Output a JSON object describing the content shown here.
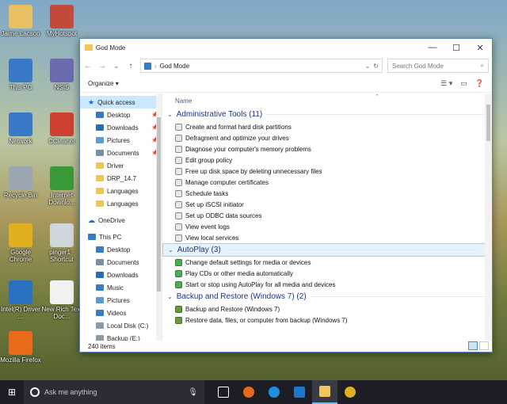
{
  "desktop": {
    "icons": [
      {
        "label": "Jaime Lacson",
        "icon": "user-folder-icon",
        "color": "#e8c064"
      },
      {
        "label": "MyHotspot",
        "icon": "hotspot-icon",
        "color": "#c44a3c"
      },
      {
        "label": "This PC",
        "icon": "computer-icon",
        "color": "#3a78c8"
      },
      {
        "label": "NSIS",
        "icon": "installer-icon",
        "color": "#6b6bb0"
      },
      {
        "label": "Network",
        "icon": "network-icon",
        "color": "#3a78c8"
      },
      {
        "label": "CCleaner",
        "icon": "ccleaner-icon",
        "color": "#d04030"
      },
      {
        "label": "Recycle Bin",
        "icon": "recycle-bin-icon",
        "color": "#9aa6b0"
      },
      {
        "label": "Internet Downlo...",
        "icon": "download-manager-icon",
        "color": "#3a9a3a"
      },
      {
        "label": "Google Chrome",
        "icon": "chrome-icon",
        "color": "#e0b020"
      },
      {
        "label": "pinger1 - Shortcut",
        "icon": "shortcut-icon",
        "color": "#cfd6dc"
      },
      {
        "label": "Intel(R) Driver ...",
        "icon": "intel-driver-icon",
        "color": "#2a70c0"
      },
      {
        "label": "New Rich Text Doc...",
        "icon": "document-icon",
        "color": "#f2f2f2"
      },
      {
        "label": "Mozilla Firefox",
        "icon": "firefox-icon",
        "color": "#e86a1a"
      }
    ]
  },
  "window": {
    "title": "God Mode",
    "address": "God Mode",
    "search_placeholder": "Search God Mode",
    "organize_label": "Organize",
    "column_name": "Name",
    "status_text": "240 items"
  },
  "nav": {
    "quick_access": "Quick access",
    "quick_items": [
      {
        "label": "Desktop",
        "icon": "desktop-icon",
        "color": "#3a78c8",
        "pinned": true
      },
      {
        "label": "Downloads",
        "icon": "downloads-icon",
        "color": "#2a6ab8",
        "pinned": true
      },
      {
        "label": "Pictures",
        "icon": "pictures-icon",
        "color": "#5a9ad8",
        "pinned": true
      },
      {
        "label": "Documents",
        "icon": "documents-icon",
        "color": "#7a8ea8",
        "pinned": true
      },
      {
        "label": "Driver",
        "icon": "folder-icon",
        "color": "#f0c85a",
        "pinned": false
      },
      {
        "label": "DRP_14.7",
        "icon": "folder-icon",
        "color": "#f0c85a",
        "pinned": false
      },
      {
        "label": "Languages",
        "icon": "folder-icon",
        "color": "#f0c85a",
        "pinned": false
      },
      {
        "label": "Languages",
        "icon": "folder-icon",
        "color": "#f0c85a",
        "pinned": false
      }
    ],
    "onedrive": "OneDrive",
    "this_pc": "This PC",
    "pc_items": [
      {
        "label": "Desktop",
        "icon": "desktop-icon",
        "color": "#3a78c8"
      },
      {
        "label": "Documents",
        "icon": "documents-icon",
        "color": "#7a8ea8"
      },
      {
        "label": "Downloads",
        "icon": "downloads-icon",
        "color": "#2a6ab8"
      },
      {
        "label": "Music",
        "icon": "music-icon",
        "color": "#3a78c8"
      },
      {
        "label": "Pictures",
        "icon": "pictures-icon",
        "color": "#5a9ad8"
      },
      {
        "label": "Videos",
        "icon": "videos-icon",
        "color": "#3a78c8"
      },
      {
        "label": "Local Disk (C:)",
        "icon": "disk-icon",
        "color": "#8a9aa8"
      },
      {
        "label": "Backup (E:)",
        "icon": "disk-icon",
        "color": "#8a9aa8"
      }
    ]
  },
  "groups": [
    {
      "title": "Administrative Tools (11)",
      "selected": false,
      "icon_class": "",
      "items": [
        "Create and format hard disk partitions",
        "Defragment and optimize your drives",
        "Diagnose your computer's memory problems",
        "Edit group policy",
        "Free up disk space by deleting unnecessary files",
        "Manage computer certificates",
        "Schedule tasks",
        "Set up iSCSI initiator",
        "Set up ODBC data sources",
        "View event logs",
        "View local services"
      ]
    },
    {
      "title": "AutoPlay (3)",
      "selected": true,
      "icon_class": "ap",
      "items": [
        "Change default settings for media or devices",
        "Play CDs or other media automatically",
        "Start or stop using AutoPlay for all media and devices"
      ]
    },
    {
      "title": "Backup and Restore (Windows 7) (2)",
      "selected": false,
      "icon_class": "br",
      "items": [
        "Backup and Restore (Windows 7)",
        "Restore data, files, or computer from backup (Windows 7)"
      ]
    }
  ],
  "taskbar": {
    "search_placeholder": "Ask me anything",
    "apps": [
      {
        "name": "task-view-icon",
        "color": "#ffffff",
        "active": false
      },
      {
        "name": "firefox-icon",
        "color": "#e86a1a",
        "active": false
      },
      {
        "name": "ie-icon",
        "color": "#1e90e0",
        "active": false
      },
      {
        "name": "store-icon",
        "color": "#1e78c8",
        "active": false
      },
      {
        "name": "file-explorer-icon",
        "color": "#f0c85a",
        "active": true
      },
      {
        "name": "chrome-icon",
        "color": "#e0b020",
        "active": false
      }
    ]
  }
}
